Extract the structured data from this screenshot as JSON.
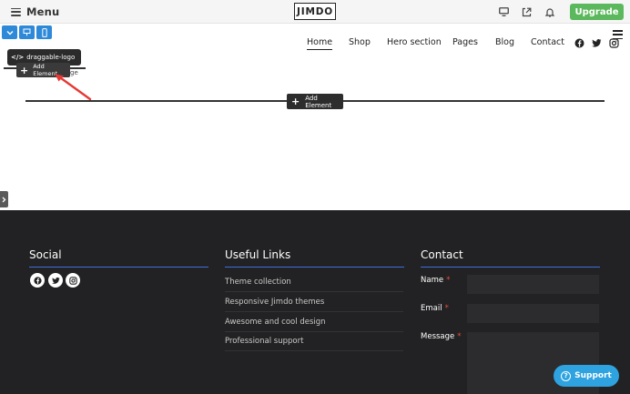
{
  "topbar": {
    "menu_label": "Menu",
    "brand": "JIMDO",
    "upgrade_label": "Upgrade",
    "icons": [
      "desktop-icon",
      "share-icon",
      "bell-icon"
    ]
  },
  "views": [
    "dropdown-chevron-icon",
    "tablet-icon",
    "mobile-icon"
  ],
  "nav": {
    "items": [
      {
        "label": "Home",
        "active": true
      },
      {
        "label": "Shop",
        "active": false
      },
      {
        "label": "Hero section",
        "active": false
      },
      {
        "label": "Pages",
        "active": false
      },
      {
        "label": "Blog",
        "active": false
      },
      {
        "label": "Contact",
        "active": false
      }
    ],
    "social_icons": [
      "facebook-icon",
      "twitter-icon",
      "instagram-icon"
    ]
  },
  "logo_element": {
    "tag_label": "draggable-logo",
    "add_label": "Add Element",
    "partial_text": "ge"
  },
  "section": {
    "add_label": "Add Element"
  },
  "footer": {
    "social_title": "Social",
    "links_title": "Useful Links",
    "contact_title": "Contact",
    "links": [
      "Theme collection",
      "Responsive Jimdo themes",
      "Awesome and cool design",
      "Professional support"
    ],
    "form": {
      "name_label": "Name",
      "email_label": "Email",
      "message_label": "Message",
      "required_mark": "*"
    }
  },
  "support_label": "Support",
  "colors": {
    "accent": "#2e8ad8",
    "upgrade": "#5cb85c",
    "footer_bg": "#222224",
    "footer_rule": "#3c6fd6",
    "arrow": "#e53935",
    "support": "#2ea3e0"
  }
}
